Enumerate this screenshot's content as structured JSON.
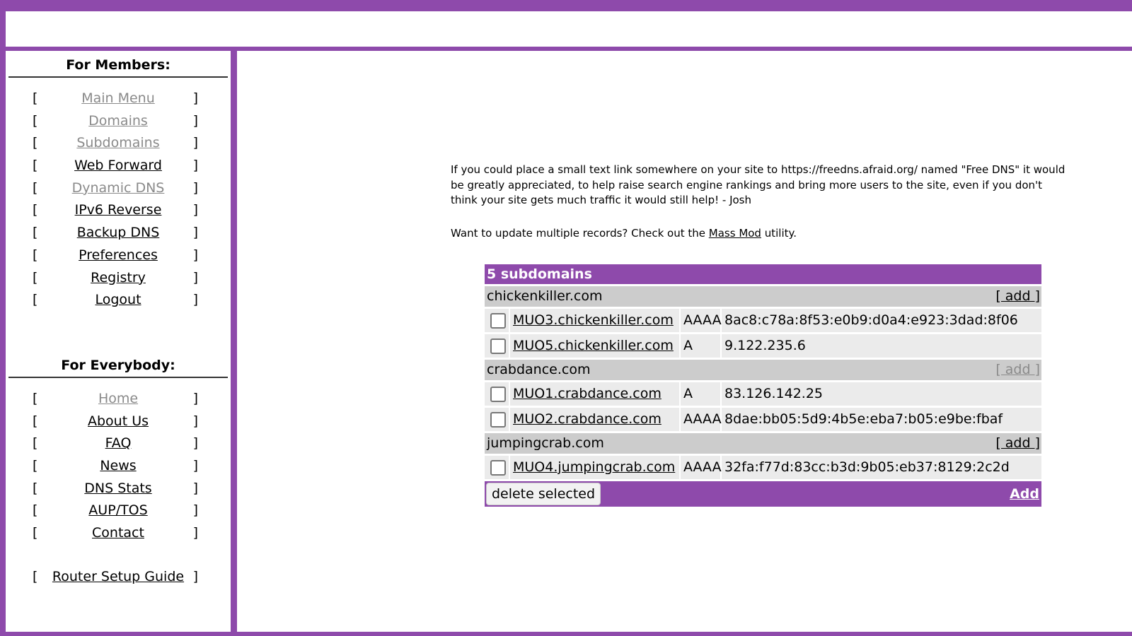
{
  "sidebar": {
    "members_heading": "For Members:",
    "members_items": [
      {
        "label": "Main Menu",
        "muted": true
      },
      {
        "label": "Domains",
        "muted": true
      },
      {
        "label": "Subdomains",
        "muted": true
      },
      {
        "label": "Web Forward",
        "muted": false
      },
      {
        "label": "Dynamic DNS",
        "muted": true
      },
      {
        "label": "IPv6 Reverse",
        "muted": false
      },
      {
        "label": "Backup DNS",
        "muted": false
      },
      {
        "label": "Preferences",
        "muted": false
      },
      {
        "label": "Registry",
        "muted": false
      },
      {
        "label": "Logout",
        "muted": false
      }
    ],
    "everybody_heading": "For Everybody:",
    "everybody_items": [
      {
        "label": "Home",
        "muted": true
      },
      {
        "label": "About Us",
        "muted": false
      },
      {
        "label": "FAQ",
        "muted": false
      },
      {
        "label": "News",
        "muted": false
      },
      {
        "label": "DNS Stats",
        "muted": false
      },
      {
        "label": "AUP/TOS",
        "muted": false
      },
      {
        "label": "Contact",
        "muted": false
      }
    ],
    "router_guide": "Router Setup Guide",
    "bracket_open": "[",
    "bracket_close": "]"
  },
  "notice": {
    "text": "If you could place a small text link somewhere on your site to https://freedns.afraid.org/ named \"Free DNS\" it would be greatly appreciated, to help raise search engine rankings and bring more users to the site, even if you don't think your site gets much traffic it would still help! - Josh",
    "mass_prefix": "Want to update multiple records? Check out the ",
    "mass_link": "Mass Mod",
    "mass_suffix": " utility."
  },
  "table": {
    "title": "5 subdomains",
    "add_label": "[ add ]",
    "domains": [
      {
        "name": "chickenkiller.com",
        "add_muted": false,
        "records": [
          {
            "name": "MUO3.chickenkiller.com",
            "type": "AAAA",
            "value": "8ac8:c78a:8f53:e0b9:d0a4:e923:3dad:8f06"
          },
          {
            "name": "MUO5.chickenkiller.com",
            "type": "A",
            "value": "9.122.235.6"
          }
        ]
      },
      {
        "name": "crabdance.com",
        "add_muted": true,
        "records": [
          {
            "name": "MUO1.crabdance.com",
            "type": "A",
            "value": "83.126.142.25"
          },
          {
            "name": "MUO2.crabdance.com",
            "type": "AAAA",
            "value": "8dae:bb05:5d9:4b5e:eba7:b05:e9be:fbaf"
          }
        ]
      },
      {
        "name": "jumpingcrab.com",
        "add_muted": false,
        "records": [
          {
            "name": "MUO4.jumpingcrab.com",
            "type": "AAAA",
            "value": "32fa:f77d:83cc:b3d:9b05:eb37:8129:2c2d"
          }
        ]
      }
    ],
    "delete_button": "delete selected",
    "add_bottom": "Add"
  },
  "colors": {
    "accent": "#8e4aab",
    "domain_row": "#cccccc",
    "record_cell": "#ebebeb",
    "muted_link": "#8a8a8a"
  }
}
